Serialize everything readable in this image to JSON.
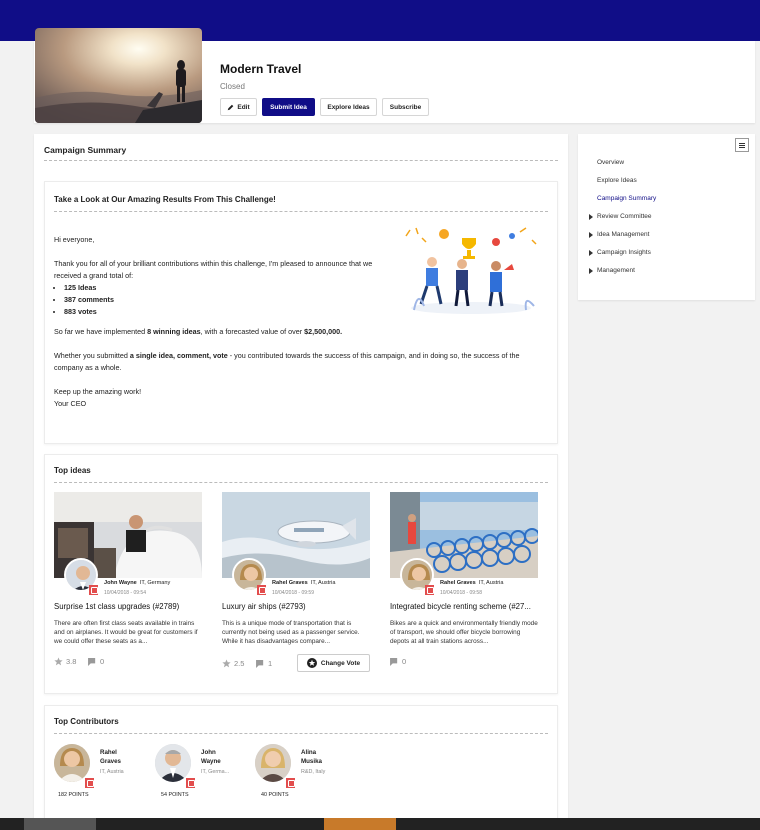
{
  "campaign": {
    "title": "Modern Travel",
    "status": "Closed"
  },
  "actions": {
    "edit": "Edit",
    "submit": "Submit Idea",
    "explore": "Explore Ideas",
    "subscribe": "Subscribe"
  },
  "summary": {
    "section_title": "Campaign Summary",
    "card_title": "Take a Look at Our Amazing Results From This Challenge!",
    "greeting": "Hi everyone,",
    "intro": "Thank you for all of your brilliant contributions within this challenge, I'm pleased to announce that we received a grand total of:",
    "stats": [
      "125 Ideas",
      "387 comments",
      "883 votes"
    ],
    "implemented_pre": "So far we have implemented ",
    "implemented_bold": "8 winning ideas",
    "implemented_mid": ", with a forecasted value of over ",
    "implemented_value": "$2,500,000.",
    "contrib_pre": "Whether you submitted ",
    "contrib_bold": "a single idea, comment, vote",
    "contrib_post": " - you contributed towards the success of this campaign, and in doing so, the success of the company as a whole.",
    "closing1": "Keep up the amazing work!",
    "closing2": "Your CEO"
  },
  "top_ideas": {
    "title": "Top ideas",
    "items": [
      {
        "author": "John Wayne",
        "location": "IT, Germany",
        "date": "10/04/2018 - 09:54",
        "title": "Surprise 1st class upgrades (#2789)",
        "desc": "There are often first class seats available in trains and on airplanes. It would be great for customers if we could offer these seats as a...",
        "rating": "3.8",
        "comments": "0"
      },
      {
        "author": "Rahel Graves",
        "location": "IT, Austria",
        "date": "10/04/2018 - 09:59",
        "title": "Luxury air ships (#2793)",
        "desc": "This is a unique mode of transportation that is currently not being used as a passenger service. While it has disadvantages compare...",
        "rating": "2.5",
        "comments": "1",
        "vote_label": "Change Vote"
      },
      {
        "author": "Rahel Graves",
        "location": "IT, Austria",
        "date": "10/04/2018 - 09:58",
        "title": "Integrated bicycle renting scheme (#27...",
        "desc": "Bikes are a quick and environmentally friendly mode of transport, we should offer bicycle borrowing depots at all train stations across...",
        "comments": "0"
      }
    ]
  },
  "contributors": {
    "title": "Top Contributors",
    "items": [
      {
        "first": "Rahel",
        "last": "Graves",
        "location": "IT, Austria",
        "points": "182 POINTS"
      },
      {
        "first": "John",
        "last": "Wayne",
        "location": "IT, Germa...",
        "points": "54 POINTS"
      },
      {
        "first": "Alina",
        "last": "Musika",
        "location": "R&D, Italy",
        "points": "40 POINTS"
      }
    ]
  },
  "sidebar": {
    "items": [
      {
        "label": "Overview"
      },
      {
        "label": "Explore Ideas"
      },
      {
        "label": "Campaign Summary"
      },
      {
        "label": "Review Committee"
      },
      {
        "label": "Idea Management"
      },
      {
        "label": "Campaign Insights"
      },
      {
        "label": "Management"
      }
    ]
  },
  "colors": {
    "brand": "#100d87",
    "badge": "#e24d4d",
    "accent_bar": "#c87a2a"
  }
}
